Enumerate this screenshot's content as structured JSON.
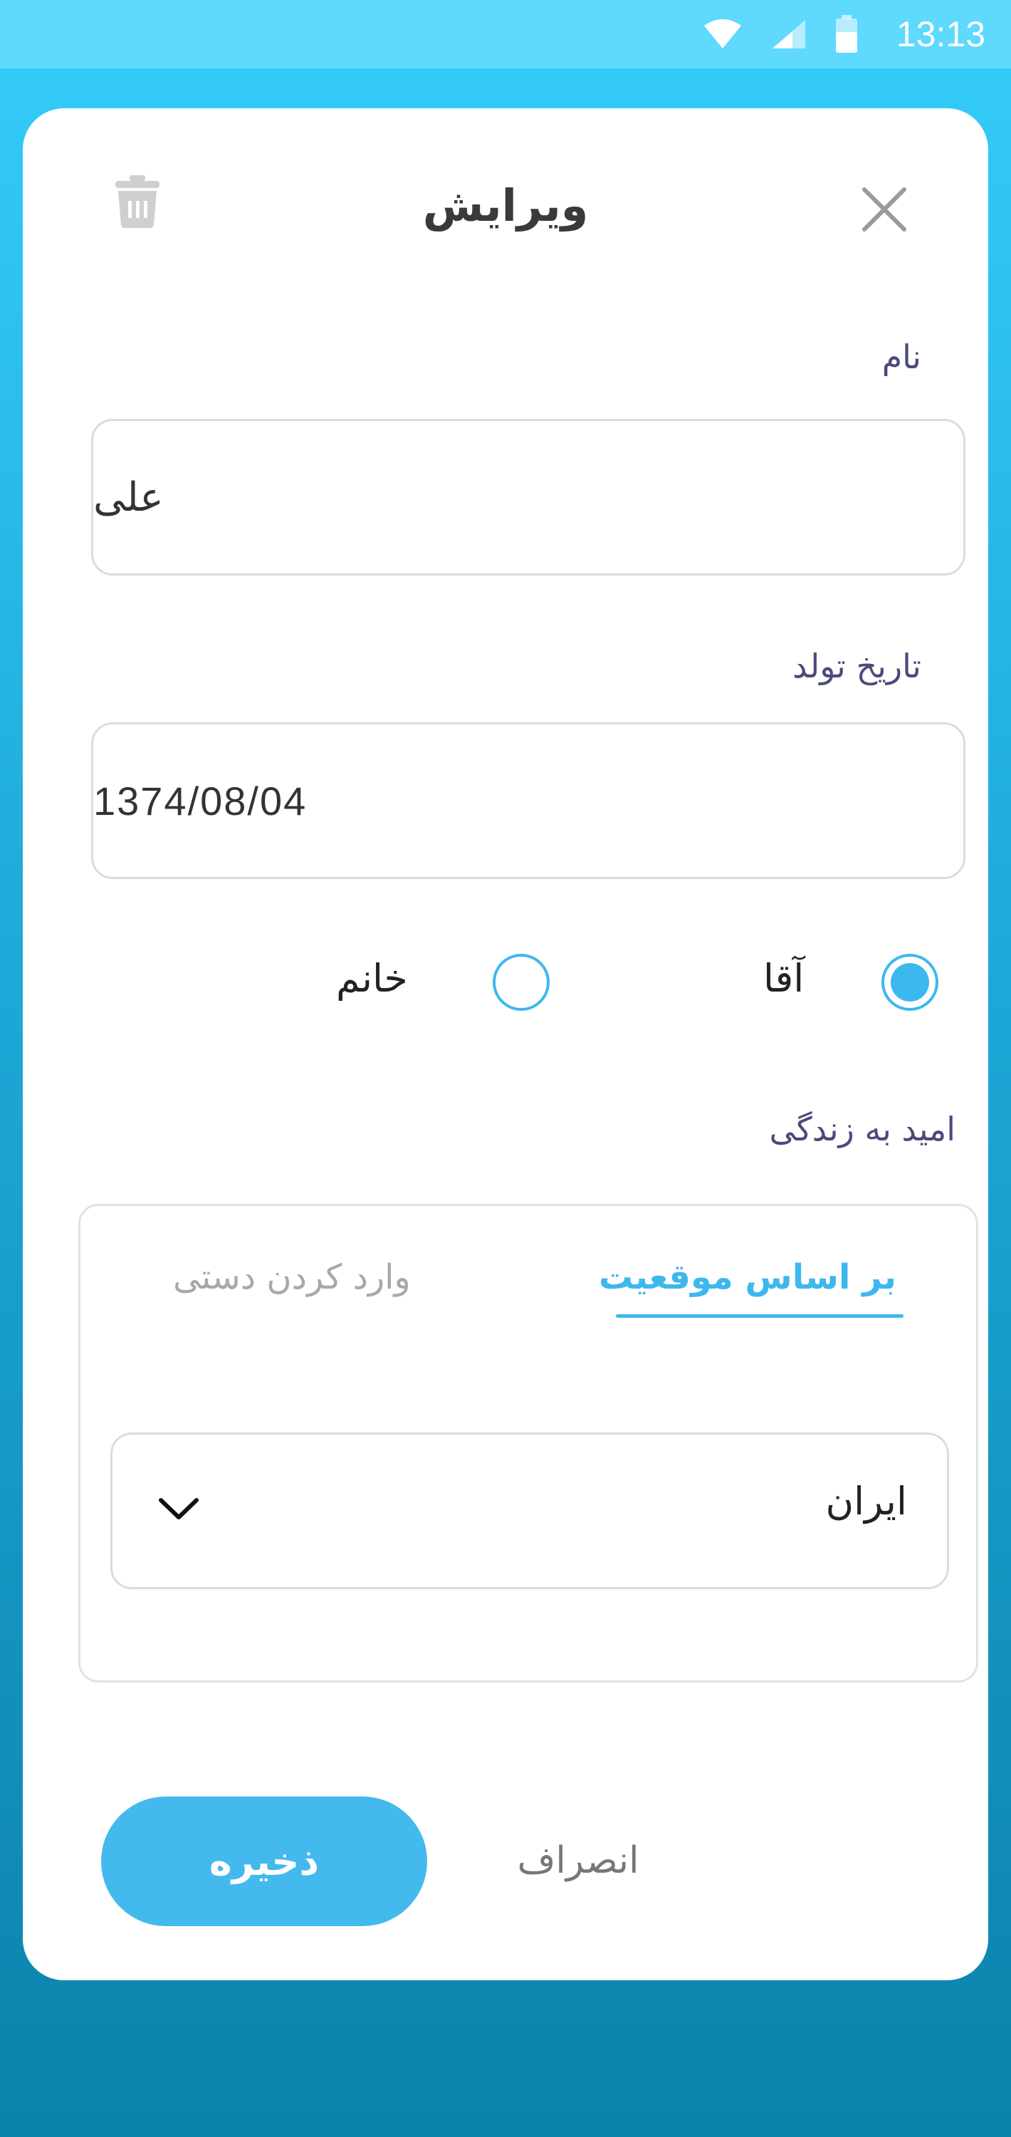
{
  "status_bar": {
    "time": "13:13",
    "icons": [
      "wifi-icon",
      "cellular-signal-icon",
      "battery-icon"
    ]
  },
  "dialog": {
    "title": "ویرایش",
    "close_icon": "close-icon",
    "delete_icon": "trash-icon"
  },
  "name_field": {
    "label": "نام",
    "value": "علی"
  },
  "birthdate_field": {
    "label": "تاریخ تولد",
    "value": "1374/08/04"
  },
  "gender": {
    "options": [
      {
        "label": "آقا",
        "selected": true
      },
      {
        "label": "خانم",
        "selected": false
      }
    ]
  },
  "life_expectancy": {
    "label": "امید به زندگی",
    "tabs": [
      {
        "label": "بر اساس موقعیت",
        "active": true
      },
      {
        "label": "وارد کردن دستی",
        "active": false
      }
    ],
    "country_select": {
      "value": "ایران",
      "icon": "chevron-down-icon"
    }
  },
  "actions": {
    "save_label": "ذخیره",
    "cancel_label": "انصراف"
  },
  "colors": {
    "accent": "#44b9ee",
    "status_bar": "#5fd9fd",
    "background_top": "#35cdfb",
    "background_bottom": "#0b82ab"
  }
}
